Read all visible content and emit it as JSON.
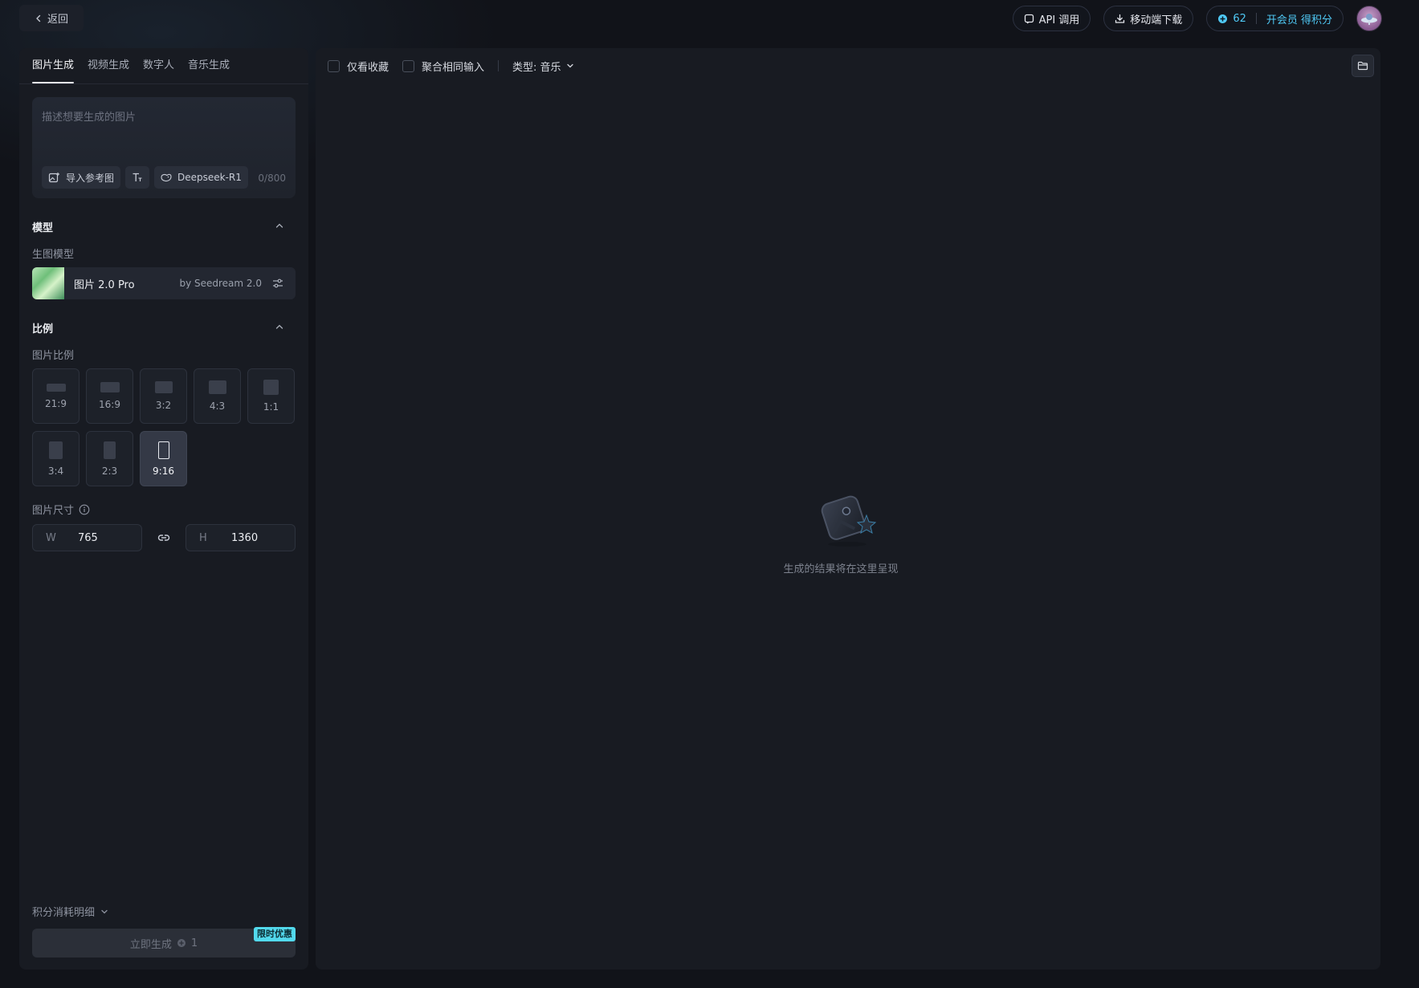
{
  "topbar": {
    "back_label": "返回",
    "api_label": "API 调用",
    "download_label": "移动端下载",
    "credits": "62",
    "vip_label": "开会员 得积分"
  },
  "tabs": [
    {
      "label": "图片生成",
      "active": true
    },
    {
      "label": "视频生成",
      "active": false
    },
    {
      "label": "数字人",
      "active": false
    },
    {
      "label": "音乐生成",
      "active": false
    }
  ],
  "prompt": {
    "placeholder": "描述想要生成的图片",
    "import_ref_label": "导入参考图",
    "deepseek_label": "Deepseek-R1",
    "char_count": "0/800"
  },
  "model": {
    "section_title": "模型",
    "sub_label": "生图模型",
    "name": "图片 2.0 Pro",
    "by": "by Seedream 2.0"
  },
  "ratio": {
    "section_title": "比例",
    "sub_label": "图片比例",
    "options": [
      "21:9",
      "16:9",
      "3:2",
      "4:3",
      "1:1",
      "3:4",
      "2:3",
      "9:16"
    ],
    "selected": "9:16"
  },
  "size": {
    "label": "图片尺寸",
    "w_label": "W",
    "w_value": "765",
    "h_label": "H",
    "h_value": "1360"
  },
  "footer": {
    "cost_detail_label": "积分消耗明细",
    "generate_label": "立即生成",
    "generate_cost": "1",
    "promo_badge": "限时优惠"
  },
  "main": {
    "favorites_only_label": "仅看收藏",
    "merge_same_input_label": "聚合相同输入",
    "type_filter_label": "类型: 音乐",
    "empty_text": "生成的结果将在这里呈现"
  },
  "colors": {
    "accent": "#4fc9f5",
    "promo": "#52d9ec",
    "background": "#111319",
    "panel": "#181b22"
  }
}
